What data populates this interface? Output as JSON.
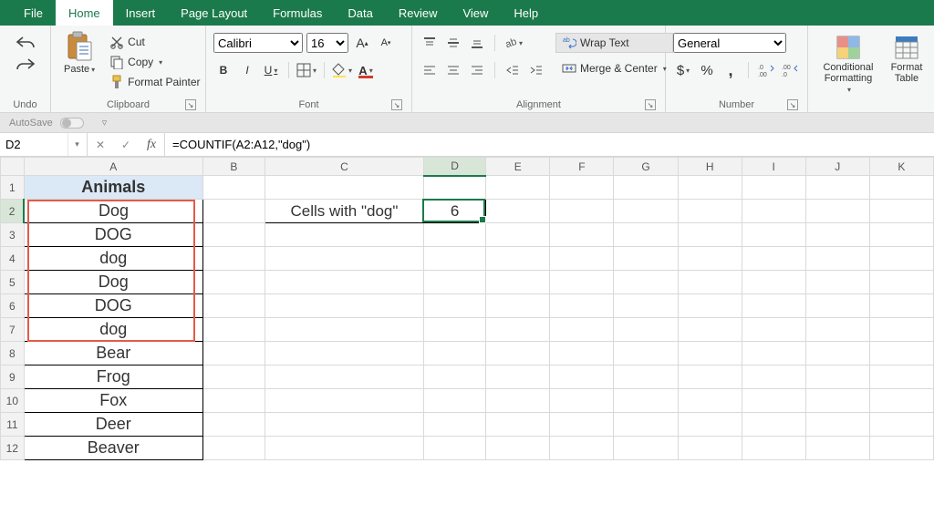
{
  "tabs": [
    "File",
    "Home",
    "Insert",
    "Page Layout",
    "Formulas",
    "Data",
    "Review",
    "View",
    "Help"
  ],
  "active_tab": "Home",
  "ribbon": {
    "undo": {
      "label": "Undo"
    },
    "clipboard": {
      "label": "Clipboard",
      "paste": "Paste",
      "cut": "Cut",
      "copy": "Copy",
      "format_painter": "Format Painter"
    },
    "font": {
      "label": "Font",
      "name": "Calibri",
      "size": "16",
      "bold": "B",
      "italic": "I",
      "underline": "U"
    },
    "alignment": {
      "label": "Alignment",
      "wrap": "Wrap Text",
      "merge": "Merge & Center"
    },
    "number": {
      "label": "Number",
      "format": "General"
    },
    "styles": {
      "conditional": "Conditional Formatting",
      "format_table": "Format Table"
    }
  },
  "autosave_label": "AutoSave",
  "namebox": "D2",
  "formula": "=COUNTIF(A2:A12,\"dog\")",
  "columns": [
    "A",
    "B",
    "C",
    "D",
    "E",
    "F",
    "G",
    "H",
    "I",
    "J",
    "K"
  ],
  "rows": [
    "1",
    "2",
    "3",
    "4",
    "5",
    "6",
    "7",
    "8",
    "9",
    "10",
    "11",
    "12"
  ],
  "cells": {
    "A1": "Animals",
    "A2": "Dog",
    "A3": "DOG",
    "A4": "dog",
    "A5": "Dog",
    "A6": "DOG",
    "A7": "dog",
    "A8": "Bear",
    "A9": "Frog",
    "A10": "Fox",
    "A11": "Deer",
    "A12": "Beaver",
    "C2": "Cells with \"dog\"",
    "D2": "6"
  },
  "selected_cell": "D2"
}
